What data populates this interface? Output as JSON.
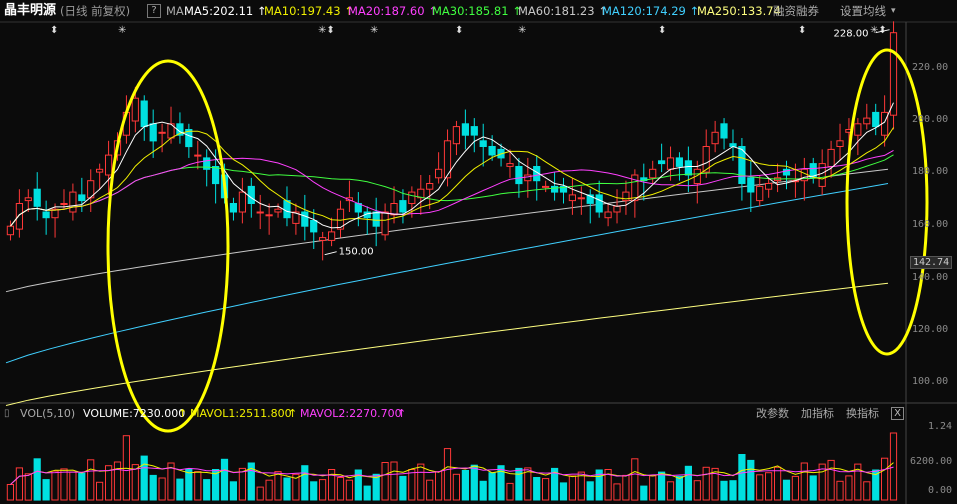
{
  "header": {
    "stock_name": "晶丰明源",
    "cycle_label": "(日线 前复权)",
    "help_label": "?",
    "ma_label": "MA",
    "ma_items": [
      {
        "label": "MA5:202.11",
        "arrow": "↑",
        "color": "#ffffff"
      },
      {
        "label": "MA10:197.43",
        "arrow": "↑",
        "color": "#f0f000"
      },
      {
        "label": "MA20:187.60",
        "arrow": "↑",
        "color": "#ff40ff"
      },
      {
        "label": "MA30:185.81",
        "arrow": "↑",
        "color": "#40ff40"
      },
      {
        "label": "MA60:181.23",
        "arrow": "↑",
        "color": "#c8c8c8"
      },
      {
        "label": "MA120:174.29",
        "arrow": "↑",
        "color": "#40d0ff"
      },
      {
        "label": "MA250:133.74",
        "arrow": "",
        "color": "#ffff80"
      }
    ],
    "financing_label": "融资融券",
    "settings_label": "设置均线"
  },
  "volume_header": {
    "vol_label": "VOL(5,10)",
    "volume_item": "VOLUME:7230.000",
    "mavol1": "MAVOL1:2511.800",
    "mavol2": "MAVOL2:2270.700",
    "modify_label": "改参数",
    "add_label": "加指标",
    "switch_label": "换指标",
    "close_label": "X"
  },
  "price_axis": {
    "ticks": [
      "220.00",
      "200.00",
      "180.00",
      "160.00",
      "140.00",
      "120.00",
      "100.00"
    ],
    "current_price": "142.74"
  },
  "volume_axis": {
    "ticks": [
      "1.24",
      "6200.00",
      "0.00"
    ]
  },
  "annotations": {
    "high_label": "228.00",
    "low_label": "150.00"
  },
  "event_marks": [
    "⬍",
    "✳",
    "✳⬍",
    "✳",
    "⬍",
    "✳",
    "⬍",
    "⬍",
    "✳⬍"
  ],
  "colors": {
    "up": "#ff3838",
    "down": "#00e0e0",
    "background": "#0b0b0b",
    "highlight_ellipse": "#ffff00"
  },
  "chart_data": {
    "type": "candlestick",
    "price_range": [
      100,
      230
    ],
    "closes": [
      160,
      168,
      170,
      167,
      163,
      166,
      168,
      172,
      169,
      176,
      180,
      185,
      190,
      200,
      205,
      195,
      190,
      193,
      196,
      192,
      188,
      185,
      180,
      175,
      170,
      165,
      172,
      168,
      165,
      164,
      166,
      163,
      165,
      160,
      158,
      156,
      158,
      166,
      170,
      165,
      163,
      160,
      165,
      168,
      165,
      172,
      173,
      175,
      180,
      190,
      195,
      192,
      192,
      188,
      185,
      184,
      182,
      175,
      178,
      176,
      174,
      172,
      172,
      171,
      170,
      168,
      165,
      165,
      167,
      172,
      178,
      176,
      180,
      182,
      184,
      181,
      178,
      180,
      188,
      193,
      191,
      188,
      175,
      172,
      174,
      175,
      177,
      178,
      176,
      180,
      177,
      182,
      187,
      190,
      194,
      196,
      198,
      195,
      200,
      228
    ],
    "ma250": [
      97,
      140
    ],
    "ma120": [
      112,
      175
    ],
    "ma60": [
      137,
      180
    ]
  }
}
